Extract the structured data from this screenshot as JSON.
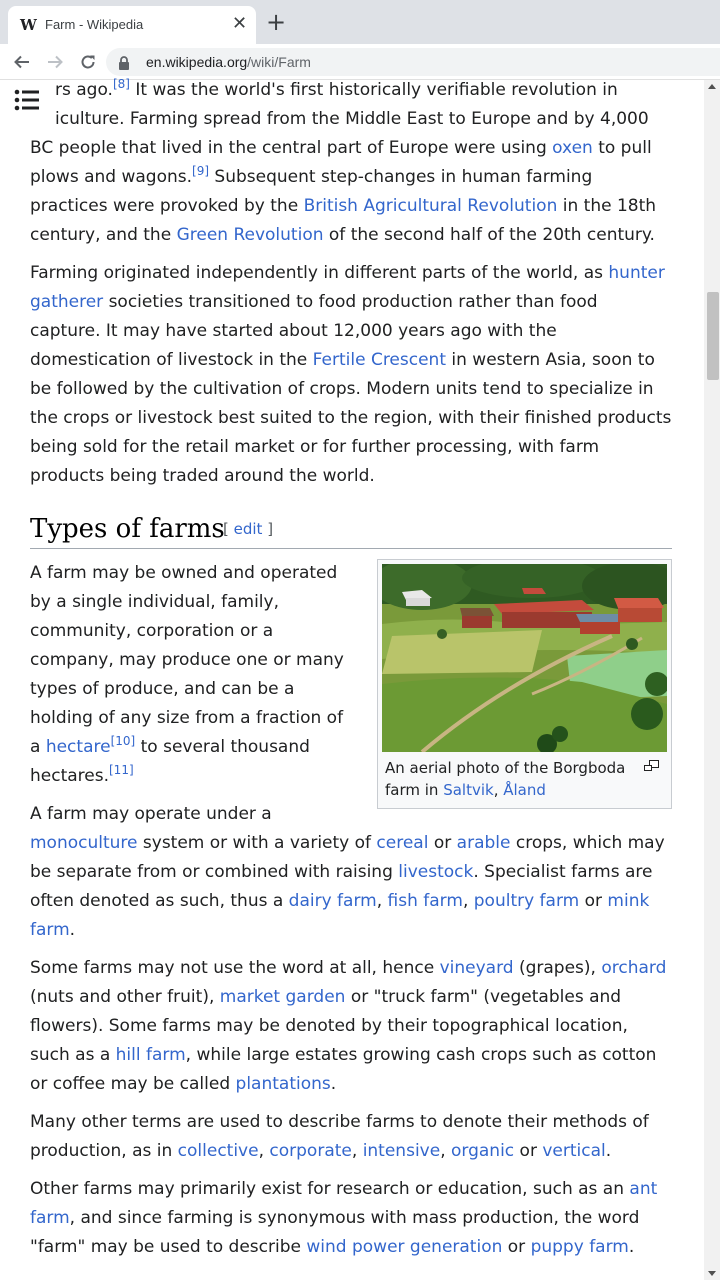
{
  "browser": {
    "tab_title": "Farm - Wikipedia",
    "tab_favicon": "W",
    "url_host": "en.wikipedia.org",
    "url_path": "/wiki/Farm",
    "icons": [
      "back-arrow-icon",
      "forward-arrow-icon",
      "reload-icon",
      "lock-icon",
      "close-icon",
      "plus-icon"
    ]
  },
  "page": {
    "p1": {
      "t1": "rs ago.",
      "ref1": "[8]",
      "t2": " It was the world's first historically verifiable revolution in ",
      "t3": "iculture. Farming spread from the Middle East to Europe and by 4,000 BC people that lived in the central part of Europe were using ",
      "link_oxen": "oxen",
      "t4": " to pull plows and wagons.",
      "ref2": "[9]",
      "t5": " Subsequent step-changes in human farming practices were provoked by the ",
      "link_bar": "British Agricultural Revolution",
      "t6": " in the 18th century, and the ",
      "link_gr": "Green Revolution",
      "t7": " of the second half of the 20th century."
    },
    "p2": {
      "t1": "Farming originated independently in different parts of the world, as ",
      "link_hg": "hunter gatherer",
      "t2": " societies transitioned to food production rather than food capture. It may have started about 12,000 years ago with the domestication of livestock in the ",
      "link_fc": "Fertile Crescent",
      "t3": " in western Asia, soon to be followed by the cultivation of crops. Modern units tend to specialize in the crops or livestock best suited to the region, with their finished products being sold for the retail market or for further processing, with farm products being traded around the world."
    },
    "section": {
      "title": "Types of farms",
      "edit_open": "[ ",
      "edit_label": "edit",
      "edit_close": " ]"
    },
    "figure": {
      "caption_text": "An aerial photo of the Borgboda farm in ",
      "link_saltvik": "Saltvik",
      "sep": ", ",
      "link_aland": "Åland"
    },
    "p3": {
      "t1": "A farm may be owned and operated by a single individual, family, community, corporation or a company, may produce one or many types of produce, and can be a holding of any size from a fraction of a ",
      "link_hectare": "hectare",
      "ref1": "[10]",
      "t2": " to several thousand hectares.",
      "ref2": "[11]"
    },
    "p4": {
      "t1": "A farm may operate under a ",
      "link_mono": "monoculture",
      "t2": " system or with a variety of ",
      "link_cereal": "cereal",
      "t3": " or ",
      "link_arable": "arable",
      "t4": " crops, which may be separate from or combined with raising ",
      "link_livestock": "livestock",
      "t5": ". Specialist farms are often denoted as such, thus a ",
      "link_dairy": "dairy farm",
      "sep1": ", ",
      "link_fish": "fish farm",
      "sep2": ", ",
      "link_poultry": "poultry farm",
      "t6": " or ",
      "link_mink": "mink farm",
      "t7": "."
    },
    "p5": {
      "t1": "Some farms may not use the word at all, hence ",
      "link_vineyard": "vineyard",
      "t2": " (grapes), ",
      "link_orchard": "orchard",
      "t3": " (nuts and other fruit), ",
      "link_market": "market garden",
      "t4": " or \"truck farm\" (vegetables and flowers). Some farms may be denoted by their topographical location, such as a ",
      "link_hill": "hill farm",
      "t5": ", while large estates growing cash crops such as cotton or coffee may be called ",
      "link_plantations": "plantations",
      "t6": "."
    },
    "p6": {
      "t1": "Many other terms are used to describe farms to denote their methods of production, as in ",
      "link_collective": "collective",
      "sep1": ", ",
      "link_corporate": "corporate",
      "sep2": ", ",
      "link_intensive": "intensive",
      "sep3": ", ",
      "link_organic": "organic",
      "t2": " or ",
      "link_vertical": "vertical",
      "t3": "."
    },
    "p7": {
      "t1": "Other farms may primarily exist for research or education, such as an ",
      "link_ant": "ant farm",
      "t2": ", and since farming is synonymous with mass production, the word \"farm\" may be used to describe ",
      "link_wind": "wind power generation",
      "t3": " or ",
      "link_puppy": "puppy farm",
      "t4": "."
    }
  }
}
